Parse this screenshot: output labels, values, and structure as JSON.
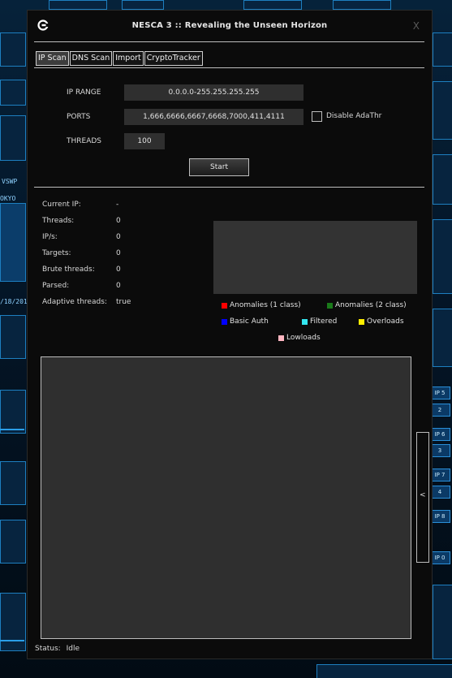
{
  "window": {
    "title": "NESCA 3 :: Revealing the Unseen Horizon",
    "close_label": "X"
  },
  "tabs": [
    {
      "label": "IP Scan",
      "active": true
    },
    {
      "label": "DNS Scan",
      "active": false
    },
    {
      "label": "Import",
      "active": false
    },
    {
      "label": "CryptoTracker",
      "active": false
    }
  ],
  "scan": {
    "ip_range_label": "IP RANGE",
    "ip_range_value": "0.0.0.0-255.255.255.255",
    "ports_label": "PORTS",
    "ports_value": "1,666,6666,6667,6668,7000,411,4111",
    "disable_adathr_label": "Disable AdaThr",
    "disable_adathr_checked": false,
    "threads_label": "THREADS",
    "threads_value": "100",
    "start_label": "Start"
  },
  "stats": [
    {
      "label": "Current IP:",
      "value": "-"
    },
    {
      "label": "Threads:",
      "value": "0"
    },
    {
      "label": "IP/s:",
      "value": "0"
    },
    {
      "label": "Targets:",
      "value": "0"
    },
    {
      "label": "Brute threads:",
      "value": "0"
    },
    {
      "label": "Parsed:",
      "value": "0"
    },
    {
      "label": "Adaptive threads:",
      "value": "true"
    }
  ],
  "legend": [
    {
      "label": "Anomalies (1 class)",
      "color": "#ff0000"
    },
    {
      "label": "Anomalies (2 class)",
      "color": "#1a7a1a"
    },
    {
      "label": "Basic Auth",
      "color": "#0000ff"
    },
    {
      "label": "Filtered",
      "color": "#33e6f0"
    },
    {
      "label": "Overloads",
      "color": "#ffee00"
    },
    {
      "label": "Lowloads",
      "color": "#ffb6c1"
    }
  ],
  "side_toggle_label": "<",
  "status": {
    "label": "Status:",
    "value": "Idle"
  },
  "background": {
    "labels": [
      "VSWP",
      "OKYO",
      "/18/201",
      "IP 5",
      "IP 6",
      "IP 7",
      "IP 8",
      "IP 0",
      "2",
      "3",
      "4"
    ]
  },
  "colors": {
    "window_bg": "#0b0b0b",
    "field_bg": "#2f2f2f",
    "graph_bg": "#333333",
    "wallpaper_accent": "#2a9ee8"
  }
}
